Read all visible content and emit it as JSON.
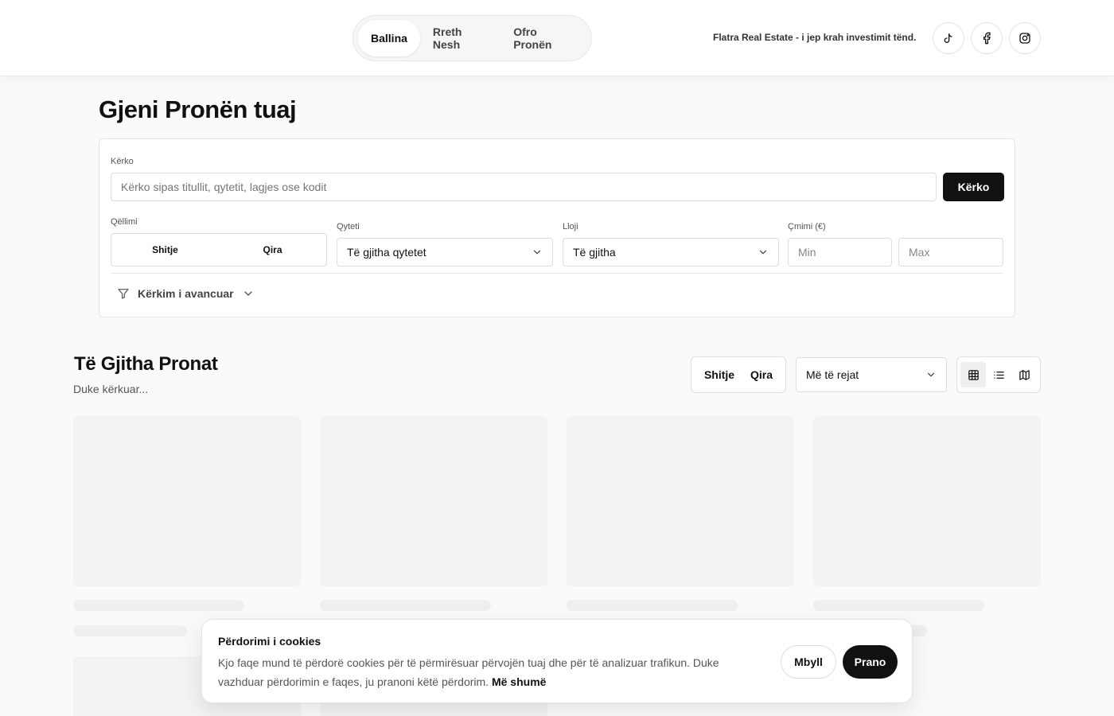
{
  "header": {
    "nav": [
      {
        "label": "Ballina",
        "active": true
      },
      {
        "label": "Rreth Nesh",
        "active": false
      },
      {
        "label": "Ofro Pronën",
        "active": false
      }
    ],
    "tagline": "Flatra Real Estate - i jep krah investimit tënd.",
    "social": [
      "tiktok-icon",
      "facebook-icon",
      "instagram-icon"
    ]
  },
  "page": {
    "title": "Gjeni Pronën tuaj"
  },
  "search": {
    "label": "Kërko",
    "placeholder": "Kërko sipas titullit, qytetit, lagjes ose kodit",
    "value": "",
    "button_label": "Kërko",
    "purpose": {
      "label": "Qëllimi",
      "options": [
        "Shitje",
        "Qira"
      ]
    },
    "city": {
      "label": "Qyteti",
      "selected": "Të gjitha qytetet"
    },
    "type": {
      "label": "Lloji",
      "selected": "Të gjitha"
    },
    "price": {
      "label": "Çmimi (€)",
      "min_placeholder": "Min",
      "max_placeholder": "Max"
    },
    "advanced_label": "Kërkim i avancuar"
  },
  "listing": {
    "title": "Të Gjitha Pronat",
    "status": "Duke kërkuar...",
    "type_options": [
      "Shitje",
      "Qira"
    ],
    "sort_selected": "Më të rejat",
    "views": [
      {
        "icon": "grid-icon",
        "active": true
      },
      {
        "icon": "list-icon",
        "active": false
      },
      {
        "icon": "map-icon",
        "active": false
      }
    ]
  },
  "cookie": {
    "title": "Përdorimi i cookies",
    "text": "Kjo faqe mund të përdorë cookies për të përmirësuar përvojën tuaj dhe për të analizuar trafikun. Duke vazhduar përdorimin e faqes, ju pranoni këtë përdorim.",
    "more_label": "Më shumë",
    "close_label": "Mbyll",
    "accept_label": "Prano"
  },
  "colors": {
    "accent": "#111111",
    "background": "#fafafa",
    "skeleton": "#f3f3f3"
  }
}
